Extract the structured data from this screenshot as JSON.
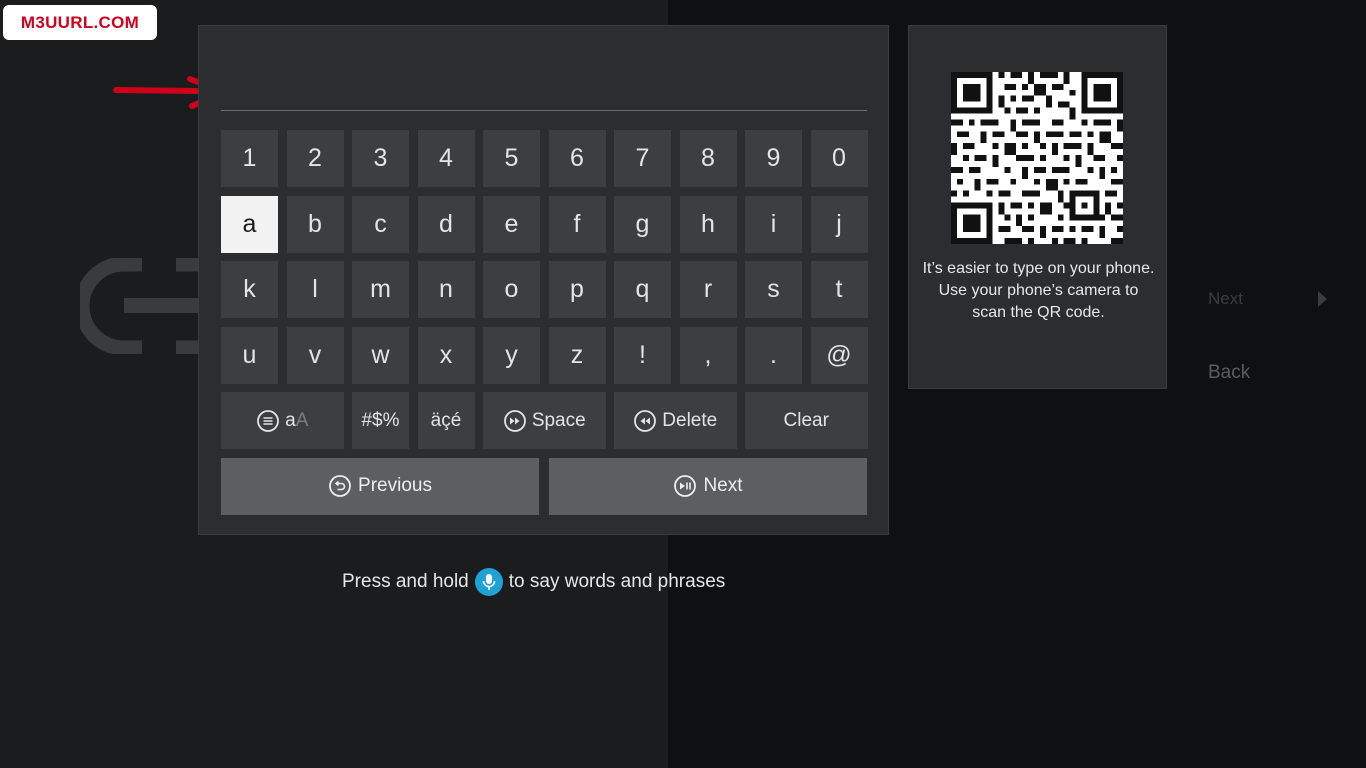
{
  "watermark": {
    "text": "M3UURL.COM"
  },
  "background": {
    "next_label": "Next",
    "back_label": "Back"
  },
  "text_entry": {
    "value": ""
  },
  "keyboard": {
    "rows": [
      [
        "1",
        "2",
        "3",
        "4",
        "5",
        "6",
        "7",
        "8",
        "9",
        "0"
      ],
      [
        "a",
        "b",
        "c",
        "d",
        "e",
        "f",
        "g",
        "h",
        "i",
        "j"
      ],
      [
        "k",
        "l",
        "m",
        "n",
        "o",
        "p",
        "q",
        "r",
        "s",
        "t"
      ],
      [
        "u",
        "v",
        "w",
        "x",
        "y",
        "z",
        "!",
        ",",
        ".",
        "@"
      ]
    ],
    "focused_key": "a",
    "function_keys": {
      "case_label_lower": "a",
      "case_label_upper": "A",
      "symbols_label": "#$%",
      "accents_label": "äçé",
      "space_label": "Space",
      "delete_label": "Delete",
      "clear_label": "Clear"
    },
    "previous_label": "Previous",
    "next_label": "Next"
  },
  "voice_hint": {
    "before": "Press and hold",
    "after": "to say words and phrases"
  },
  "qr_panel": {
    "text": "It’s easier to type on your phone. Use your phone’s camera to scan the QR code."
  },
  "colors": {
    "accent_mic": "#1fa3d7",
    "focused_key": "#f2f2f2",
    "watermark_red": "#d0021b",
    "arrow_red": "#d0021b"
  }
}
